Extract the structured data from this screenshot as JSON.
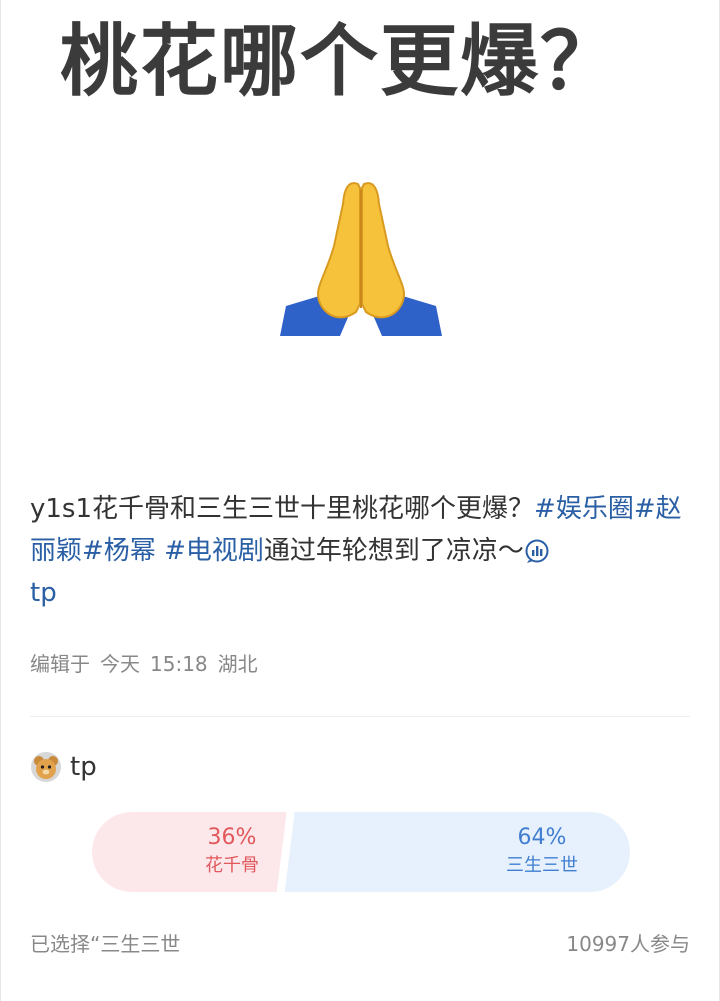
{
  "hero": {
    "title": "桃花哪个更爆？"
  },
  "post": {
    "prefix": "y1s1花千骨和三生三世十里桃花哪个更爆？",
    "tags": [
      "#娱乐圈",
      "#赵丽颖",
      "#杨幂",
      "#电视剧"
    ],
    "suffix": "通过年轮想到了凉凉～",
    "link_label": "tp",
    "meta": {
      "label": "编辑于",
      "day": "今天",
      "time": "15:18",
      "location": "湖北"
    }
  },
  "poll": {
    "title": "tp",
    "option_a": {
      "label": "花千骨",
      "percent": "36%",
      "share": 0.36,
      "color": "#fce8ea"
    },
    "option_b": {
      "label": "三生三世",
      "percent": "64%",
      "share": 0.64,
      "color": "#e7f1fd"
    },
    "selected_text": "已选择“三生三世",
    "participants": "10997人参与"
  }
}
